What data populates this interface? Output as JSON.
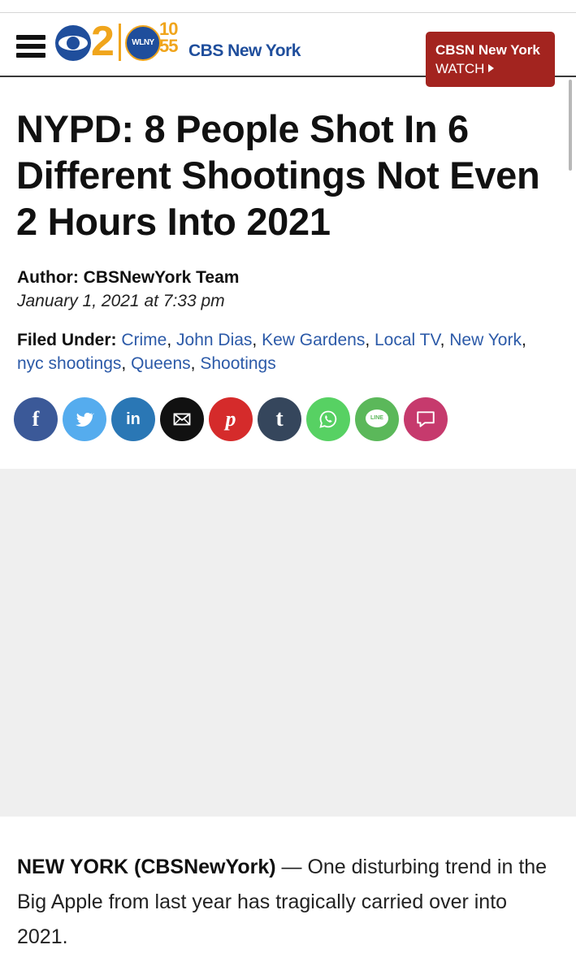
{
  "header": {
    "logo": {
      "channel_number": "2",
      "wlny_label": "WLNY",
      "wlny_number": "10 55",
      "brand_text": "CBS New York"
    },
    "watch_button": {
      "line1": "CBSN New York",
      "line2": "WATCH"
    }
  },
  "article": {
    "headline": "NYPD: 8 People Shot In 6 Different Shootings Not Even 2 Hours Into 2021",
    "author_label": "Author:",
    "author_name": "CBSNewYork Team",
    "date": "January 1, 2021 at 7:33 pm",
    "filed_under_label": "Filed Under:",
    "tags": [
      "Crime",
      "John Dias",
      "Kew Gardens",
      "Local TV",
      "New York",
      "nyc shootings",
      "Queens",
      "Shootings"
    ],
    "lede_dateline": "NEW YORK (CBSNewYork)",
    "lede_text": " — One disturbing trend in the Big Apple from last year has tragically carried over into 2021."
  },
  "share": [
    {
      "name": "facebook",
      "icon": "facebook-icon",
      "color": "#3b5998",
      "glyph": "f"
    },
    {
      "name": "twitter",
      "icon": "twitter-icon",
      "color": "#55acee",
      "glyph": ""
    },
    {
      "name": "linkedin",
      "icon": "linkedin-icon",
      "color": "#2a77b5",
      "glyph": "in"
    },
    {
      "name": "email",
      "icon": "email-icon",
      "color": "#111111",
      "glyph": ""
    },
    {
      "name": "pinterest",
      "icon": "pinterest-icon",
      "color": "#d52b2b",
      "glyph": "p"
    },
    {
      "name": "tumblr",
      "icon": "tumblr-icon",
      "color": "#35465c",
      "glyph": "t"
    },
    {
      "name": "whatsapp",
      "icon": "whatsapp-icon",
      "color": "#57d163",
      "glyph": ""
    },
    {
      "name": "line",
      "icon": "line-icon",
      "color": "#5bb85a",
      "glyph": "LINE"
    },
    {
      "name": "comments",
      "icon": "comment-icon",
      "color": "#c63a6d",
      "glyph": ""
    }
  ]
}
